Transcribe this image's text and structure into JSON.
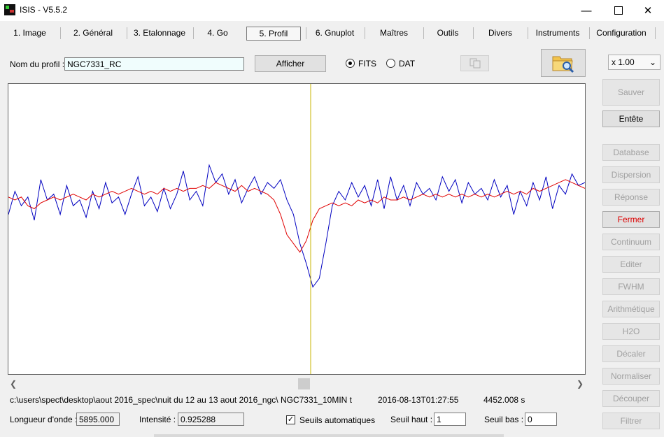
{
  "window": {
    "title": "ISIS - V5.5.2",
    "minimize_icon": "minimize-icon",
    "maximize_icon": "maximize-icon",
    "close_icon": "close-icon"
  },
  "tabs": [
    {
      "label": "1. Image"
    },
    {
      "label": "2. Général"
    },
    {
      "label": "3. Etalonnage"
    },
    {
      "label": "4. Go"
    },
    {
      "label": "5. Profil"
    },
    {
      "label": "6. Gnuplot"
    },
    {
      "label": "Maîtres"
    },
    {
      "label": "Outils"
    },
    {
      "label": "Divers"
    },
    {
      "label": "Instruments"
    },
    {
      "label": "Configuration"
    }
  ],
  "active_tab": "5. Profil",
  "toolbar": {
    "profile_label": "Nom du profil :",
    "profile_value": "NGC7331_RC",
    "show_button": "Afficher",
    "fits_label": "FITS",
    "dat_label": "DAT",
    "format_selected": "FITS",
    "copy_icon": "copy-icon",
    "open_folder_icon": "folder-search-icon"
  },
  "zoom": {
    "value": "x 1.00"
  },
  "side_buttons": [
    {
      "label": "Sauver",
      "state": "disabled"
    },
    {
      "label": "Entête",
      "state": "enabled"
    },
    {
      "label": "Database",
      "state": "disabled"
    },
    {
      "label": "Dispersion",
      "state": "disabled"
    },
    {
      "label": "Réponse",
      "state": "disabled"
    },
    {
      "label": "Fermer",
      "state": "enabled-red"
    },
    {
      "label": "Continuum",
      "state": "disabled"
    },
    {
      "label": "Editer",
      "state": "disabled"
    },
    {
      "label": "FWHM",
      "state": "disabled"
    },
    {
      "label": "Arithmétique",
      "state": "disabled"
    },
    {
      "label": "H2O",
      "state": "disabled"
    },
    {
      "label": "Décaler",
      "state": "disabled"
    },
    {
      "label": "Normaliser",
      "state": "disabled"
    },
    {
      "label": "Découper",
      "state": "disabled"
    },
    {
      "label": "Filtrer",
      "state": "disabled"
    }
  ],
  "status": {
    "path": "c:\\users\\spect\\desktop\\aout 2016_spec\\nuit du 12 au 13 aout 2016_ngc\\ NGC7331_10MIN t",
    "date": "2016-08-13T01:27:55",
    "exposure": "4452.008 s"
  },
  "bottom": {
    "wavelength_label": "Longueur d'onde :",
    "wavelength_value": "5895.000",
    "intensity_label": "Intensité :",
    "intensity_value": "0.925288",
    "auto_thresholds_label": "Seuils automatiques",
    "auto_thresholds_checked": true,
    "high_label": "Seuil haut :",
    "high_value": "1",
    "low_label": "Seuil bas :",
    "low_value": "0"
  },
  "colors": {
    "profile_blue": "#0000c0",
    "profile_red": "#e00000",
    "cursor_line": "#c8b400",
    "fermer_red": "#dd0000"
  },
  "chart_data": {
    "type": "line",
    "cursor_x": 5895.0,
    "series": [
      {
        "values": [
          0.55,
          0.63,
          0.58,
          0.61,
          0.53,
          0.67,
          0.6,
          0.62,
          0.55,
          0.65,
          0.58,
          0.6,
          0.54,
          0.63,
          0.57,
          0.66,
          0.59,
          0.61,
          0.55,
          0.62,
          0.68,
          0.58,
          0.61,
          0.56,
          0.64,
          0.57,
          0.62,
          0.7,
          0.6,
          0.63,
          0.58,
          0.72,
          0.66,
          0.69,
          0.62,
          0.67,
          0.59,
          0.64,
          0.68,
          0.62,
          0.66,
          0.64,
          0.67,
          0.6,
          0.55,
          0.45,
          0.38,
          0.3,
          0.33,
          0.45,
          0.58,
          0.63,
          0.6,
          0.66,
          0.61,
          0.65,
          0.58,
          0.67,
          0.57,
          0.68,
          0.6,
          0.65,
          0.58,
          0.66,
          0.62,
          0.64,
          0.6,
          0.68,
          0.63,
          0.67,
          0.59,
          0.66,
          0.62,
          0.64,
          0.6,
          0.67,
          0.61,
          0.65,
          0.55,
          0.63,
          0.58,
          0.66,
          0.6,
          0.68,
          0.57,
          0.65,
          0.62,
          0.69,
          0.65,
          0.66
        ]
      },
      {
        "values": [
          0.61,
          0.6,
          0.61,
          0.58,
          0.57,
          0.59,
          0.6,
          0.61,
          0.6,
          0.61,
          0.62,
          0.61,
          0.6,
          0.62,
          0.61,
          0.62,
          0.63,
          0.62,
          0.63,
          0.64,
          0.63,
          0.62,
          0.63,
          0.62,
          0.64,
          0.63,
          0.64,
          0.63,
          0.64,
          0.64,
          0.65,
          0.64,
          0.66,
          0.65,
          0.64,
          0.63,
          0.65,
          0.63,
          0.64,
          0.63,
          0.62,
          0.6,
          0.55,
          0.48,
          0.45,
          0.42,
          0.46,
          0.53,
          0.57,
          0.58,
          0.59,
          0.58,
          0.59,
          0.58,
          0.6,
          0.59,
          0.6,
          0.59,
          0.61,
          0.6,
          0.6,
          0.61,
          0.6,
          0.61,
          0.62,
          0.61,
          0.62,
          0.61,
          0.62,
          0.61,
          0.62,
          0.61,
          0.62,
          0.61,
          0.62,
          0.61,
          0.62,
          0.63,
          0.62,
          0.63,
          0.62,
          0.64,
          0.63,
          0.64,
          0.65,
          0.66,
          0.67,
          0.66,
          0.65,
          0.64
        ]
      }
    ],
    "ylim": [
      0,
      1
    ]
  }
}
